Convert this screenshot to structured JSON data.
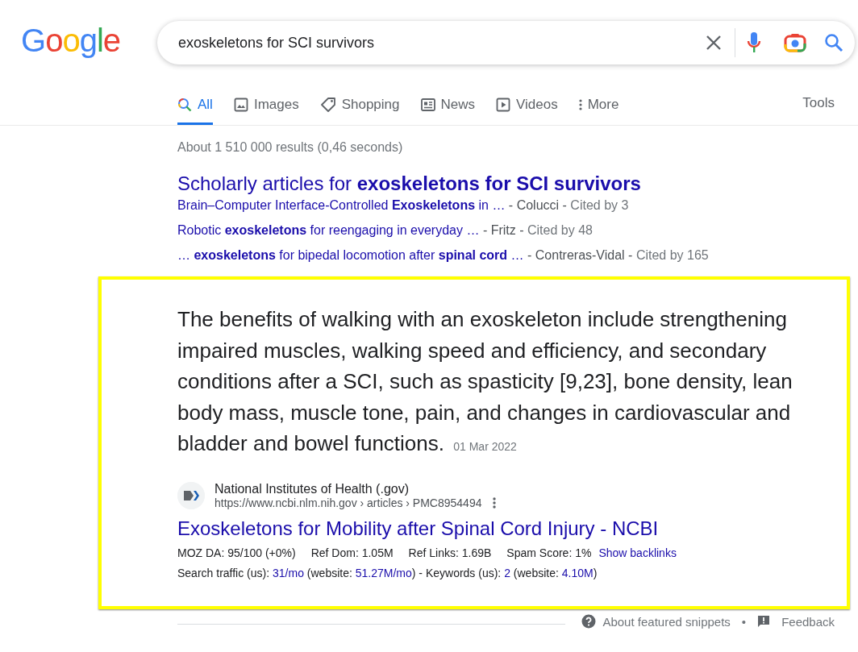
{
  "logo": "Google",
  "search": {
    "value": "exoskeletons for SCI survivors"
  },
  "tabs": [
    {
      "label": "All",
      "kind": "all",
      "selected": true
    },
    {
      "label": "Images",
      "kind": "images",
      "selected": false
    },
    {
      "label": "Shopping",
      "kind": "shopping",
      "selected": false
    },
    {
      "label": "News",
      "kind": "news",
      "selected": false
    },
    {
      "label": "Videos",
      "kind": "videos",
      "selected": false
    },
    {
      "label": "More",
      "kind": "more",
      "selected": false
    }
  ],
  "tools": "Tools",
  "result_stats": "About 1 510 000 results (0,46 seconds)",
  "scholarly": {
    "title": "Scholarly articles for **exoskeletons for SCI survivors**",
    "items": [
      {
        "title": "Brain–Computer Interface-Controlled **Exoskeletons** in …",
        "author": "- Colucci -",
        "cited": "Cited by 3"
      },
      {
        "title": "Robotic **exoskeletons** for reengaging in everyday …",
        "author": "- Fritz -",
        "cited": "Cited by 48"
      },
      {
        "title": "… **exoskeletons** for bipedal locomotion after **spinal cord** …",
        "author": "- Contreras-Vidal -",
        "cited": "Cited by 165"
      }
    ]
  },
  "snippet": {
    "text": "The benefits of walking with an exoskeleton include strengthening impaired muscles, walking speed and efficiency, and secondary conditions after a SCI, such as spasticity [9,23], bone density, lean body mass, muscle tone, pain, and changes in cardiovascular and bladder and bowel functions.",
    "date": "01 Mar 2022",
    "source": "National Institutes of Health (.gov)",
    "url": "https://www.ncbi.nlm.nih.gov › articles › PMC8954494",
    "title": "Exoskeletons for Mobility after Spinal Cord Injury - NCBI",
    "metrics": [
      {
        "text": "MOZ DA: 95/100 (+0%)",
        "kind": "stat"
      },
      {
        "text": "Ref Dom: 1.05M",
        "kind": "stat"
      },
      {
        "text": "Ref Links: 1.69B",
        "kind": "stat"
      },
      {
        "text": "Spam Score: 1%",
        "kind": "stat"
      },
      {
        "text": "Show backlinks",
        "kind": "link"
      }
    ],
    "traffic": [
      {
        "text": "Search traffic (us): ",
        "kind": "label"
      },
      {
        "text": "31/mo",
        "kind": "value"
      },
      {
        "text": " (website: ",
        "kind": "label"
      },
      {
        "text": "51.27M/mo",
        "kind": "value"
      },
      {
        "text": ") - Keywords (us): ",
        "kind": "label"
      },
      {
        "text": "2",
        "kind": "value"
      },
      {
        "text": " (website: ",
        "kind": "label"
      },
      {
        "text": "4.10M",
        "kind": "value"
      },
      {
        "text": ")",
        "kind": "label"
      }
    ]
  },
  "footer": {
    "about": "About featured snippets",
    "separator": "•",
    "feedback": "Feedback"
  }
}
